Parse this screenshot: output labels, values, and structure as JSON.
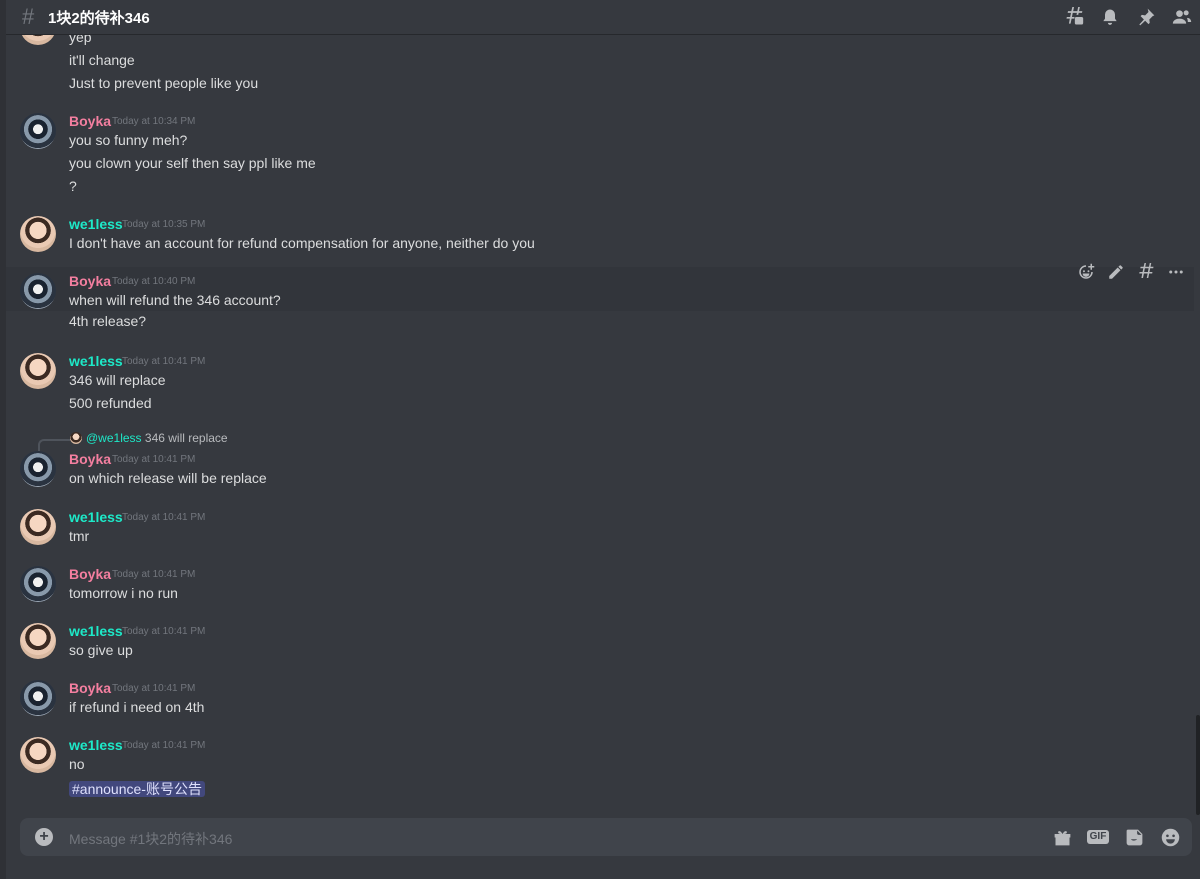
{
  "channel": {
    "name": "1块2的待补346",
    "composer_placeholder": "Message #1块2的待补346"
  },
  "header_icons": [
    "threads-icon",
    "bell-icon",
    "pin-icon",
    "members-icon"
  ],
  "message_hover_tools": [
    "add-reaction-icon",
    "edit-icon",
    "create-thread-icon",
    "more-icon"
  ],
  "colors": {
    "background": "#36393f",
    "boyka_name": "#f47fa0",
    "welless_name": "#1de9c8",
    "mention_bg": "#4a5298"
  },
  "messages": [
    {
      "author": "",
      "timestamp": "",
      "lines": [
        "yep",
        "it'll change",
        "Just to prevent people like you"
      ]
    },
    {
      "author": "Boyka",
      "timestamp": "Today at 10:34 PM",
      "lines": [
        "you so funny meh?",
        "you clown your self then say ppl like me",
        "?"
      ]
    },
    {
      "author": "we1less",
      "timestamp": "Today at 10:35 PM",
      "lines": [
        "I don't have an account for refund compensation for anyone, neither do you"
      ]
    },
    {
      "author": "Boyka",
      "timestamp": "Today at 10:40 PM",
      "lines": [
        "when will refund the 346 account?",
        "4th release?"
      ]
    },
    {
      "author": "we1less",
      "timestamp": "Today at 10:41 PM",
      "lines": [
        "346 will replace",
        "500 refunded"
      ]
    },
    {
      "author": "Boyka",
      "timestamp": "Today at 10:41 PM",
      "reply_to": {
        "author": "@we1less",
        "text": "346 will replace"
      },
      "lines": [
        "on which release will be replace"
      ]
    },
    {
      "author": "we1less",
      "timestamp": "Today at 10:41 PM",
      "lines": [
        "tmr"
      ]
    },
    {
      "author": "Boyka",
      "timestamp": "Today at 10:41 PM",
      "lines": [
        "tomorrow i no run"
      ]
    },
    {
      "author": "we1less",
      "timestamp": "Today at 10:41 PM",
      "lines": [
        "so give up"
      ]
    },
    {
      "author": "Boyka",
      "timestamp": "Today at 10:41 PM",
      "lines": [
        "if refund i need on 4th"
      ]
    },
    {
      "author": "we1less",
      "timestamp": "Today at 10:41 PM",
      "lines": [
        "no"
      ],
      "channel_mention": "#announce-账号公告"
    }
  ]
}
